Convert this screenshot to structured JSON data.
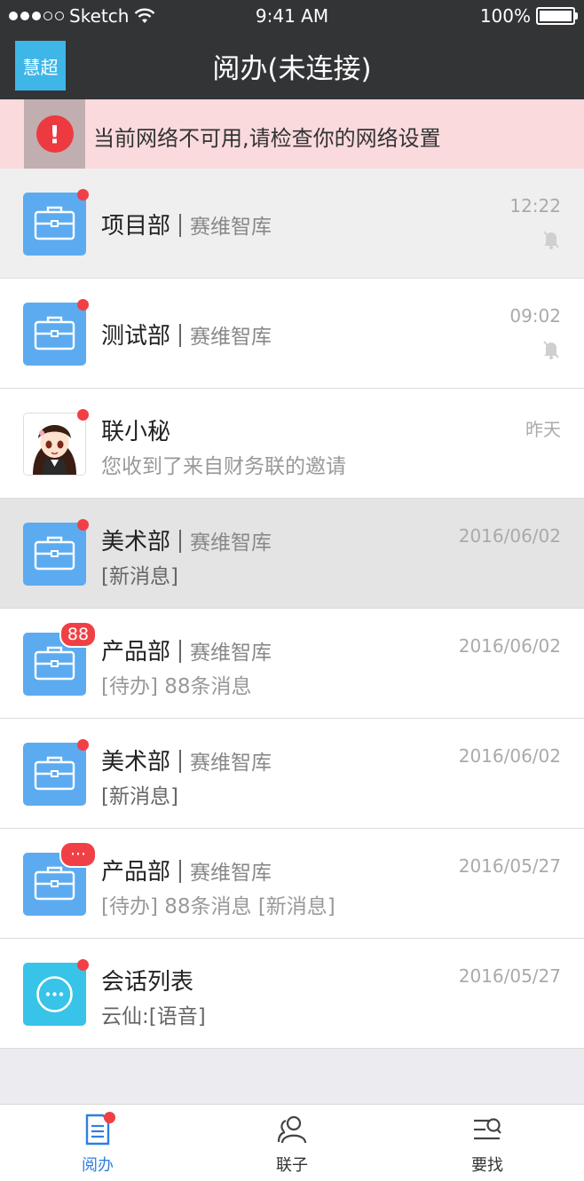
{
  "status_bar": {
    "carrier": "Sketch",
    "time": "9:41 AM",
    "battery": "100%",
    "battery_level": 1.0
  },
  "nav": {
    "avatar_label": "慧超",
    "title": "阅办(未连接)"
  },
  "banner": {
    "message": "当前网络不可用,请检查你的网络设置"
  },
  "conversations": [
    {
      "name": "项目部",
      "org": "赛维智库",
      "time": "12:22",
      "preview": "",
      "muted": true,
      "unread": "dot",
      "icon": "briefcase-icon"
    },
    {
      "name": "测试部",
      "org": "赛维智库",
      "time": "09:02",
      "preview": "",
      "muted": true,
      "unread": "dot",
      "icon": "briefcase-icon"
    },
    {
      "name": "联小秘",
      "org": "",
      "time": "昨天",
      "preview": "您收到了来自财务联的邀请",
      "muted": false,
      "unread": "dot",
      "icon": "assistant-avatar"
    },
    {
      "name": "美术部",
      "org": "赛维智库",
      "time": "2016/06/02",
      "preview": "[新消息]",
      "muted": false,
      "unread": "dot",
      "icon": "briefcase-icon"
    },
    {
      "name": "产品部",
      "org": "赛维智库",
      "time": "2016/06/02",
      "preview": "[待办] 88条消息",
      "muted": false,
      "unread": "88",
      "icon": "briefcase-icon"
    },
    {
      "name": "美术部",
      "org": "赛维智库",
      "time": "2016/06/02",
      "preview": "[新消息]",
      "muted": false,
      "unread": "dot",
      "icon": "briefcase-icon"
    },
    {
      "name": "产品部",
      "org": "赛维智库",
      "time": "2016/05/27",
      "preview": "[待办] 88条消息 [新消息]",
      "muted": false,
      "unread": "···",
      "icon": "briefcase-icon"
    },
    {
      "name": "会话列表",
      "org": "",
      "time": "2016/05/27",
      "preview": "云仙:[语音]",
      "muted": false,
      "unread": "dot",
      "icon": "chat-bubble-icon"
    }
  ],
  "tabs": [
    {
      "label": "阅办",
      "icon": "document-icon",
      "active": true
    },
    {
      "label": "联子",
      "icon": "contacts-icon",
      "active": false
    },
    {
      "label": "要找",
      "icon": "search-list-icon",
      "active": false
    }
  ],
  "colors": {
    "header": "#333436",
    "accent": "#3fb6e8",
    "icon_blue": "#5cabf0",
    "badge_red": "#f04045",
    "banner_bg": "#fadadd",
    "active_tab": "#2f7fe0"
  }
}
